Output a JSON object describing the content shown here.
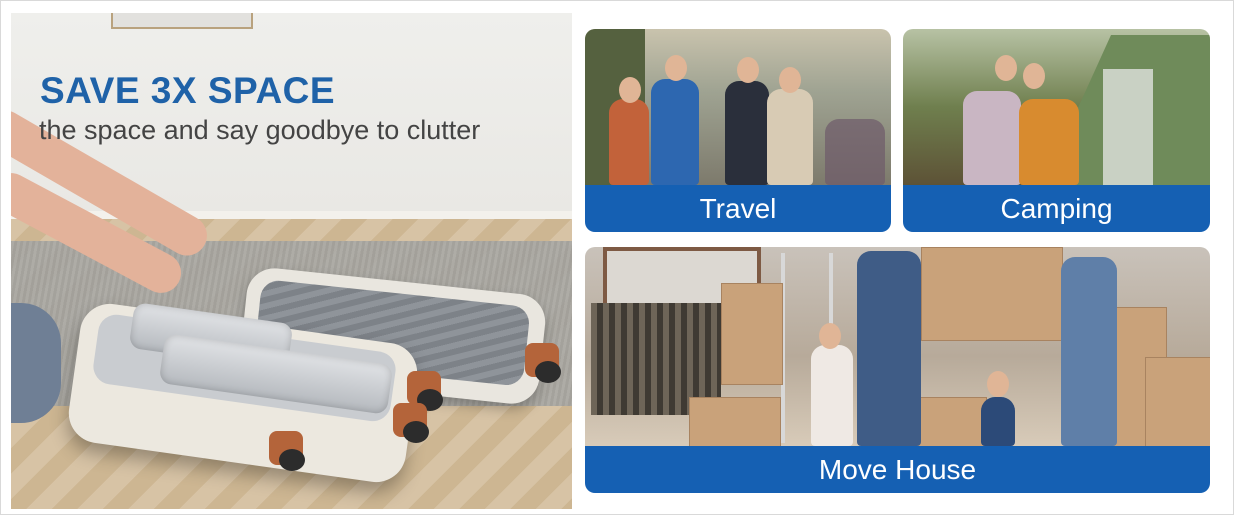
{
  "hero": {
    "title": "SAVE 3X SPACE",
    "subtitle": "the space and say goodbye to clutter"
  },
  "tiles": [
    {
      "label": "Travel"
    },
    {
      "label": "Camping"
    },
    {
      "label": "Move House"
    }
  ],
  "colors": {
    "title_blue": "#1f62a8",
    "label_bar_blue": "#1560b3",
    "subtitle_gray": "#444444"
  }
}
